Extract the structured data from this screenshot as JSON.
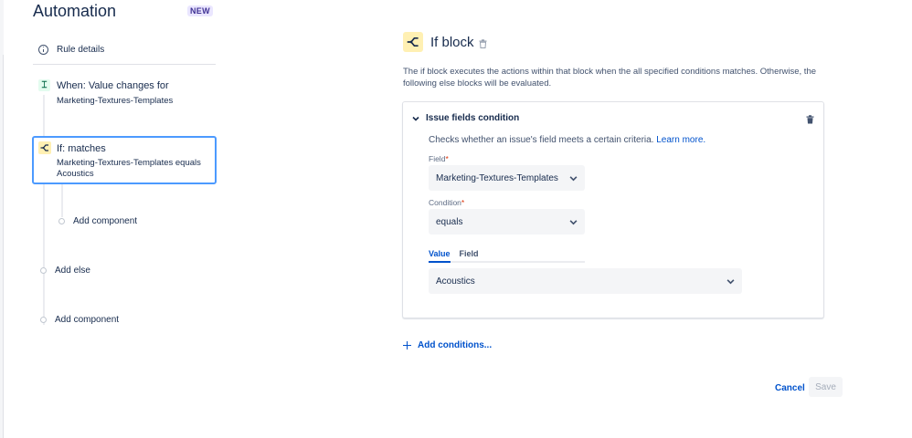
{
  "app": {
    "title": "Automation",
    "badge": "NEW"
  },
  "sidebar": {
    "rule_details": "Rule details",
    "trigger": {
      "title": "When: Value changes for",
      "subtitle": "Marketing-Textures-Templates",
      "icon": "trigger-icon"
    },
    "if_block": {
      "title": "If: matches",
      "subtitle": "Marketing-Textures-Templates equals Acoustics",
      "icon": "branch-icon"
    },
    "add_component_inner": "Add component",
    "add_else": "Add else",
    "add_component_outer": "Add component"
  },
  "panel": {
    "title": "If block",
    "description": "The if block executes the actions within that block when the all specified conditions matches. Otherwise, the following else blocks will be evaluated.",
    "condition": {
      "title": "Issue fields condition",
      "description": "Checks whether an issue's field meets a certain criteria.",
      "learn_more": "Learn more.",
      "field_label": "Field",
      "field_value": "Marketing-Textures-Templates",
      "condition_label": "Condition",
      "condition_value": "equals",
      "tabs": [
        "Value",
        "Field"
      ],
      "active_tab": "Value",
      "value": "Acoustics"
    },
    "add_conditions": "Add conditions...",
    "cancel": "Cancel",
    "save": "Save"
  },
  "colors": {
    "accent": "#0052cc",
    "selected_border": "#4c9aff",
    "branch_icon_bg": "#fff0b3",
    "trigger_icon_bg": "#e3fcef"
  }
}
